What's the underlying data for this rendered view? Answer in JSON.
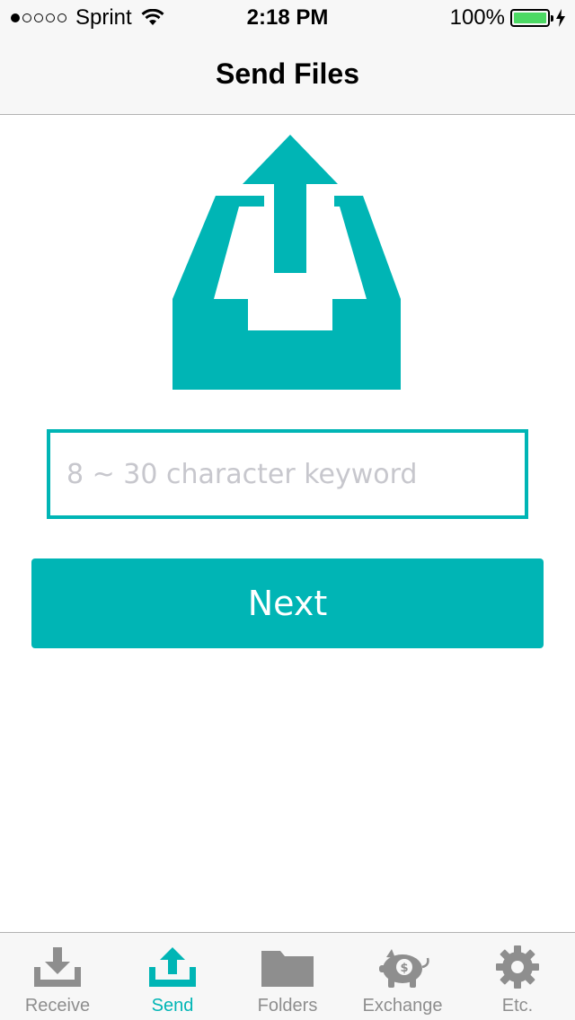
{
  "status_bar": {
    "carrier": "Sprint",
    "time": "2:18 PM",
    "battery": "100%",
    "battery_level": 1.0,
    "signal_bars_filled": 1,
    "signal_bars_total": 5
  },
  "nav": {
    "title": "Send Files"
  },
  "illustration": {
    "icon": "upload-tray-icon",
    "color": "#00b5b5"
  },
  "keyword_field": {
    "placeholder": "8 ~ 30 character keyword",
    "value": ""
  },
  "next_button": {
    "label": "Next"
  },
  "colors": {
    "accent": "#00b5b5",
    "tab_inactive": "#8e8e8e",
    "bar_background": "#f7f7f7"
  },
  "tabs": [
    {
      "label": "Receive",
      "icon": "download-icon",
      "active": false
    },
    {
      "label": "Send",
      "icon": "upload-icon",
      "active": true
    },
    {
      "label": "Folders",
      "icon": "folder-icon",
      "active": false
    },
    {
      "label": "Exchange",
      "icon": "piggy-bank-icon",
      "active": false
    },
    {
      "label": "Etc.",
      "icon": "gear-icon",
      "active": false
    }
  ]
}
